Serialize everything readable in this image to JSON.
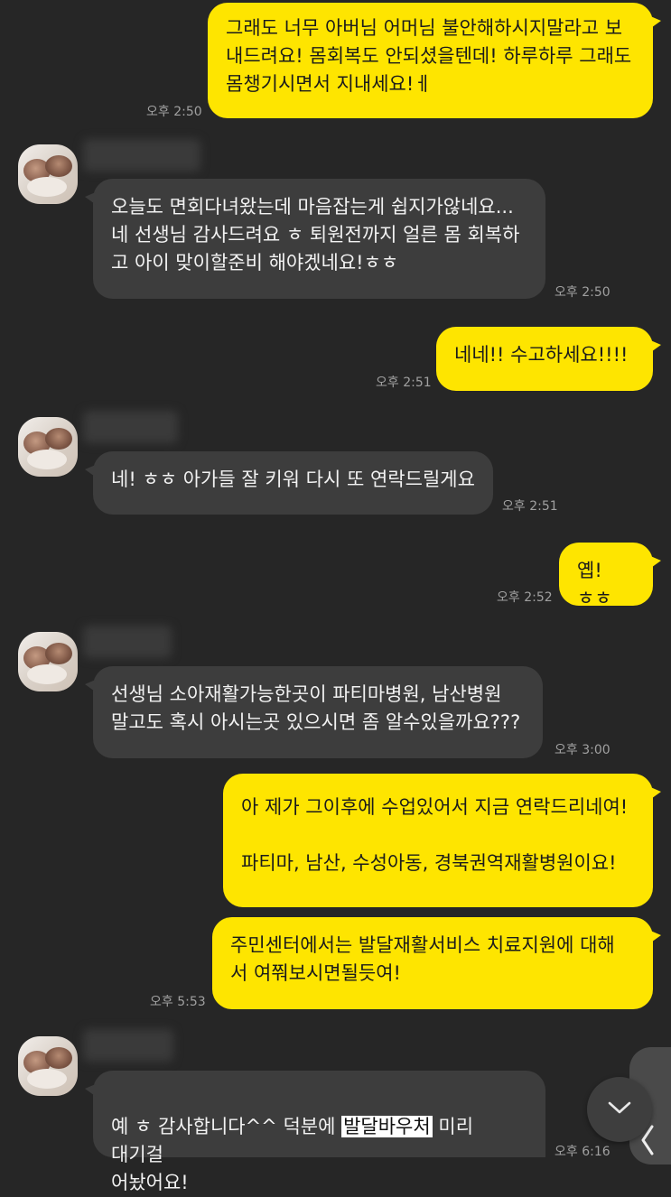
{
  "colors": {
    "background": "#262626",
    "my_bubble": "#fee500",
    "their_bubble": "#3d3d3d",
    "timestamp": "#a0a0a0"
  },
  "messages": [
    {
      "sender": "me",
      "text": "그래도 너무 아버님 어머님 불안해하시지말라고 보\n내드려요! 몸회복도 안되셨을텐데! 하루하루 그래도\n몸챙기시면서 지내세요!ㅔ",
      "time": "오후 2:50"
    },
    {
      "sender": "them",
      "text": "오늘도 면회다녀왔는데 마음잡는게 쉽지가않네요...\n네 선생님 감사드려요 ㅎ 퇴원전까지 얼른 몸 회복하\n고 아이 맞이할준비 해야겠네요!ㅎㅎ",
      "time": "오후 2:50"
    },
    {
      "sender": "me",
      "text": "네네!! 수고하세요!!!!",
      "time": "오후 2:51"
    },
    {
      "sender": "them",
      "text": "네! ㅎㅎ 아가들 잘 키워 다시 또 연락드릴게요",
      "time": "오후 2:51"
    },
    {
      "sender": "me",
      "text": "옙! ㅎㅎ",
      "time": "오후 2:52"
    },
    {
      "sender": "them",
      "text": "선생님 소아재활가능한곳이 파티마병원, 남산병원\n말고도 혹시 아시는곳 있으시면 좀 알수있을까요???",
      "time": "오후 3:00"
    },
    {
      "sender": "me",
      "text": "아 제가 그이후에 수업있어서 지금 연락드리네여!\n\n파티마, 남산, 수성아동, 경북권역재활병원이요!"
    },
    {
      "sender": "me",
      "text": "주민센터에서는 발달재활서비스 치료지원에 대해\n서 여쭤보시면될듯여!",
      "time": "오후 5:53"
    },
    {
      "sender": "them",
      "text_before": "예 ㅎ 감사합니다^^ 덕분에 ",
      "text_highlight": "발달바우처",
      "text_after": " 미리 대기걸\n어놨어요!",
      "time": "오후 6:16"
    }
  ],
  "icons": {
    "scroll_down": "chevron-down-icon",
    "side_panel": "chevron-left-icon"
  }
}
